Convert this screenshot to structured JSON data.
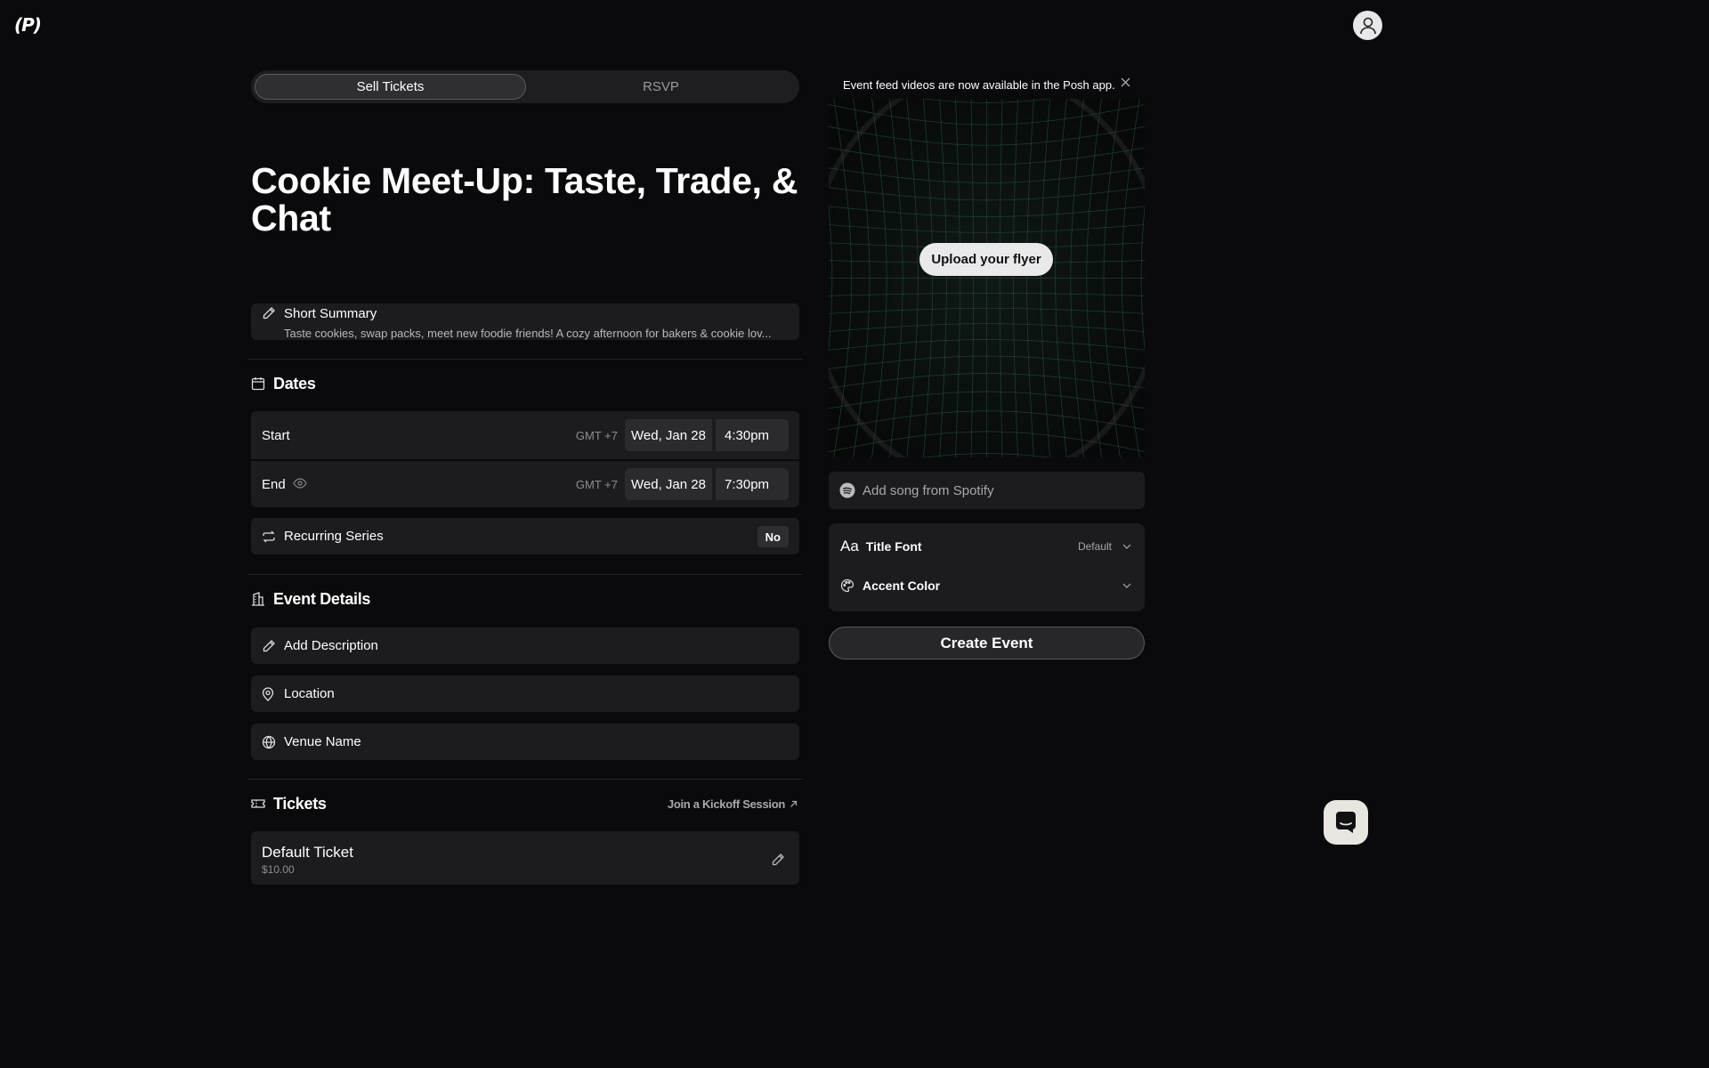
{
  "header": {
    "logo": "(P)"
  },
  "tabs": [
    {
      "label": "Sell Tickets"
    },
    {
      "label": "RSVP"
    }
  ],
  "event": {
    "title": "Cookie Meet-Up: Taste, Trade, & Chat"
  },
  "summary": {
    "label": "Short Summary",
    "text": "Taste cookies, swap packs, meet new foodie friends! A cozy afternoon for bakers & cookie lov..."
  },
  "dates": {
    "heading": "Dates",
    "start": {
      "label": "Start",
      "tz": "GMT +7",
      "date": "Wed, Jan 28",
      "time": "4:30pm"
    },
    "end": {
      "label": "End",
      "tz": "GMT +7",
      "date": "Wed, Jan 28",
      "time": "7:30pm"
    },
    "recurring": {
      "label": "Recurring Series",
      "value": "No"
    }
  },
  "details": {
    "heading": "Event Details",
    "description": "Add Description",
    "location": "Location",
    "venue": "Venue Name"
  },
  "tickets": {
    "heading": "Tickets",
    "kickoff": "Join a Kickoff Session",
    "default_name": "Default Ticket",
    "default_price": "$10.00"
  },
  "sidebar": {
    "notice": "Event feed videos are now available in the Posh app.",
    "upload": "Upload your flyer",
    "spotify": "Add song from Spotify",
    "title_font": "Title Font",
    "title_font_value": "Default",
    "title_font_glyph": "Aa",
    "accent_color": "Accent Color",
    "create": "Create Event"
  }
}
